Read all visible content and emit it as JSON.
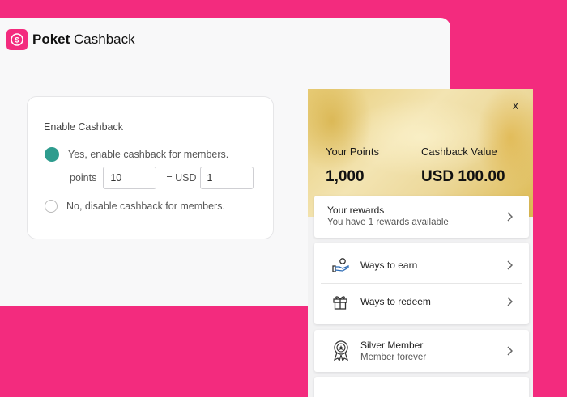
{
  "brand": {
    "bold": "Poket",
    "regular": " Cashback"
  },
  "settings": {
    "title": "Enable Cashback",
    "options": [
      {
        "label": "Yes, enable cashback for members.",
        "selected": true
      },
      {
        "label": "No, disable cashback for members.",
        "selected": false
      }
    ],
    "points_label": "points",
    "points_value": "10",
    "equals_label": "= USD",
    "usd_value": "1"
  },
  "widget": {
    "close": "x",
    "points_label": "Your Points",
    "points_value": "1,000",
    "cashback_label": "Cashback Value",
    "cashback_value": "USD 100.00",
    "rewards_title": "Your rewards",
    "rewards_subtitle": "You have 1 rewards available",
    "ways_to_earn": "Ways to earn",
    "ways_to_redeem": "Ways to redeem",
    "tier_title": "Silver Member",
    "tier_subtitle": "Member forever"
  },
  "colors": {
    "background": "#f32b7e",
    "accent_radio": "#2e9c8e",
    "banner_gold": "#e8cd79"
  },
  "icons": [
    "coin-logo-icon",
    "hand-coin-icon",
    "gift-icon",
    "medal-icon",
    "chevron-right-icon"
  ]
}
